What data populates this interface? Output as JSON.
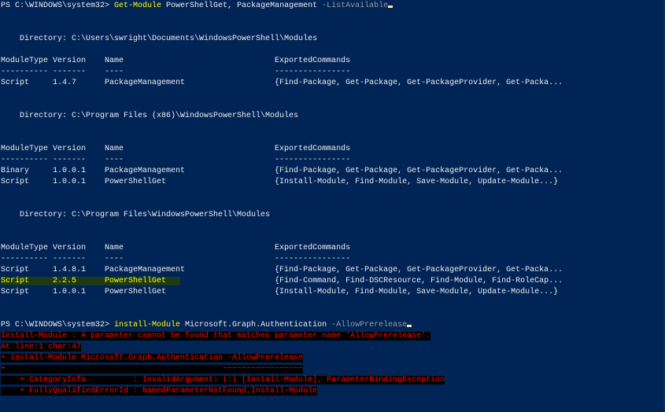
{
  "window": {
    "prompt": "PS C:\\WINDOWS\\system32> "
  },
  "lines": [
    {
      "segments": [
        {
          "t": "PS C:\\WINDOWS\\system32> ",
          "c": "w"
        },
        {
          "t": "Get-Module",
          "c": "y"
        },
        {
          "t": " PowerShellGet, PackageManagement ",
          "c": "w"
        },
        {
          "t": "-ListAvailable",
          "c": "g"
        }
      ],
      "cursor": true
    },
    {
      "segments": []
    },
    {
      "segments": []
    },
    {
      "segments": [
        {
          "t": "    Directory: C:\\Users\\swright\\Documents\\WindowsPowerShell\\Modules",
          "c": "w"
        }
      ]
    },
    {
      "segments": []
    },
    {
      "segments": [
        {
          "t": "ModuleType Version    Name                                ExportedCommands",
          "c": "w"
        }
      ]
    },
    {
      "segments": [
        {
          "t": "---------- -------    ----                                ----------------",
          "c": "w"
        }
      ]
    },
    {
      "segments": [
        {
          "t": "Script     1.4.7      PackageManagement                   {Find-Package, Get-Package, Get-PackageProvider, Get-Packa...",
          "c": "w"
        }
      ]
    },
    {
      "segments": []
    },
    {
      "segments": []
    },
    {
      "segments": [
        {
          "t": "    Directory: C:\\Program Files (x86)\\WindowsPowerShell\\Modules",
          "c": "w"
        }
      ]
    },
    {
      "segments": []
    },
    {
      "segments": []
    },
    {
      "segments": [
        {
          "t": "ModuleType Version    Name                                ExportedCommands",
          "c": "w"
        }
      ]
    },
    {
      "segments": [
        {
          "t": "---------- -------    ----                                ----------------",
          "c": "w"
        }
      ]
    },
    {
      "segments": [
        {
          "t": "Binary     1.0.0.1    PackageManagement                   {Find-Package, Get-Package, Get-PackageProvider, Get-Packa...",
          "c": "w"
        }
      ]
    },
    {
      "segments": [
        {
          "t": "Script     1.0.0.1    PowerShellGet                       {Install-Module, Find-Module, Save-Module, Update-Module...}",
          "c": "w"
        }
      ]
    },
    {
      "segments": []
    },
    {
      "segments": []
    },
    {
      "segments": [
        {
          "t": "    Directory: C:\\Program Files\\WindowsPowerShell\\Modules",
          "c": "w"
        }
      ]
    },
    {
      "segments": []
    },
    {
      "segments": []
    },
    {
      "segments": [
        {
          "t": "ModuleType Version    Name                                ExportedCommands",
          "c": "w"
        }
      ]
    },
    {
      "segments": [
        {
          "t": "---------- -------    ----                                ----------------",
          "c": "w"
        }
      ]
    },
    {
      "segments": [
        {
          "t": "Script     1.4.8.1    PackageManagement                   {Find-Package, Get-Package, Get-PackageProvider, Get-Packa...",
          "c": "w"
        }
      ]
    },
    {
      "segments": [
        {
          "t": "Script     2.2.5      PowerShellGet   ",
          "c": "hl"
        },
        {
          "t": "                    {Find-Command, Find-DSCResource, Find-Module, Find-RoleCap...",
          "c": "w"
        }
      ]
    },
    {
      "segments": [
        {
          "t": "Script     1.0.0.1    PowerShellGet                       {Install-Module, Find-Module, Save-Module, Update-Module...}",
          "c": "w"
        }
      ]
    },
    {
      "segments": []
    },
    {
      "segments": []
    },
    {
      "segments": [
        {
          "t": "PS C:\\WINDOWS\\system32> ",
          "c": "w"
        },
        {
          "t": "install-Module",
          "c": "y"
        },
        {
          "t": " Microsoft.Graph.Authentication ",
          "c": "w"
        },
        {
          "t": "-AllowPrerelease",
          "c": "g"
        }
      ],
      "cursor": true
    },
    {
      "segments": [
        {
          "t": "Install-Module : A parameter cannot be found that matches parameter name 'AllowPrerelease'.",
          "c": "err"
        }
      ]
    },
    {
      "segments": [
        {
          "t": "At line:1 char:47",
          "c": "err"
        }
      ]
    },
    {
      "segments": [
        {
          "t": "+ install-Module Microsoft.Graph.Authentication -AllowPrerelease",
          "c": "err"
        }
      ]
    },
    {
      "segments": [
        {
          "t": "+                                              ~~~~~~~~~~~~~~~~~",
          "c": "err"
        }
      ]
    },
    {
      "segments": [
        {
          "t": "    + CategoryInfo          : InvalidArgument: (:) [Install-Module], ParameterBindingException",
          "c": "err"
        }
      ]
    },
    {
      "segments": [
        {
          "t": "    + FullyQualifiedErrorId : NamedParameterNotFound,Install-Module",
          "c": "err"
        }
      ]
    }
  ]
}
